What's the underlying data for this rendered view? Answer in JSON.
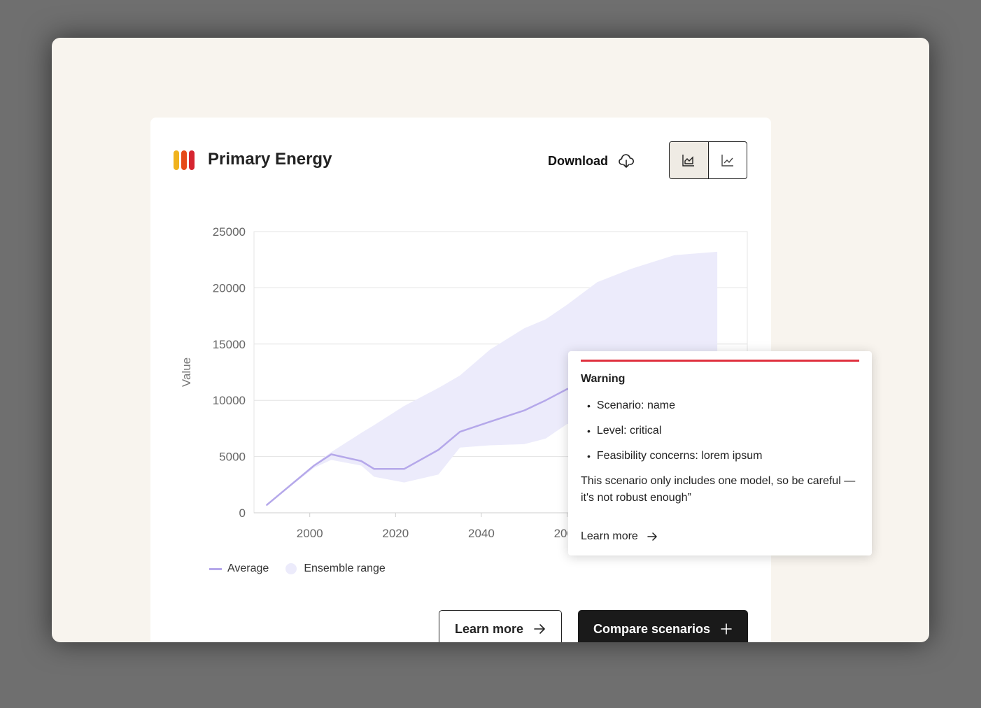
{
  "card": {
    "title": "Primary Energy",
    "download_label": "Download",
    "logo_colors": [
      "#f0b21d",
      "#e64a19",
      "#d62530"
    ],
    "toggle": [
      {
        "icon": "area-chart-icon",
        "active": true
      },
      {
        "icon": "line-chart-icon",
        "active": false
      }
    ]
  },
  "legend": {
    "average_label": "Average",
    "range_label": "Ensemble range"
  },
  "buttons": {
    "learn_more_label": "Learn more",
    "compare_label": "Compare scenarios"
  },
  "tooltip": {
    "title": "Warning",
    "items": [
      "Scenario:  name",
      "Level:  critical",
      "Feasibility concerns: lorem ipsum"
    ],
    "message": "This scenario only includes one model, so be careful —it's not robust enough”",
    "link_label": "Learn more",
    "accent_color": "#e0313e"
  },
  "chart_data": {
    "type": "line",
    "title": "Primary Energy",
    "ylabel": "Value",
    "xlabel": "",
    "ylim": [
      0,
      25000
    ],
    "xlim": [
      1987,
      2102
    ],
    "yticks": [
      0,
      5000,
      10000,
      15000,
      20000,
      25000
    ],
    "xticks": [
      "2000",
      "2020",
      "2040",
      "2060"
    ],
    "series": [
      {
        "name": "Average",
        "color": "#b5a8ea",
        "x": [
          1990,
          2001,
          2005,
          2012,
          2015,
          2022,
          2030,
          2035,
          2042,
          2050,
          2055,
          2060,
          2067,
          2075,
          2085,
          2095
        ],
        "y": [
          700,
          4200,
          5200,
          4600,
          3900,
          3900,
          5600,
          7200,
          8100,
          9100,
          10000,
          11000,
          11400,
          12400,
          13200,
          14000
        ]
      },
      {
        "name": "Ensemble range",
        "color": "#ecebfb",
        "x": [
          1990,
          2001,
          2005,
          2012,
          2015,
          2022,
          2030,
          2035,
          2042,
          2050,
          2055,
          2060,
          2067,
          2075,
          2085,
          2095
        ],
        "upper": [
          700,
          4300,
          5400,
          7100,
          7800,
          9500,
          11100,
          12200,
          14500,
          16400,
          17200,
          18500,
          20500,
          21700,
          22900,
          23200
        ],
        "lower": [
          700,
          4000,
          4700,
          4200,
          3200,
          2700,
          3400,
          5800,
          6000,
          6100,
          6600,
          7900,
          8000,
          9200,
          10800,
          12500
        ]
      }
    ]
  }
}
